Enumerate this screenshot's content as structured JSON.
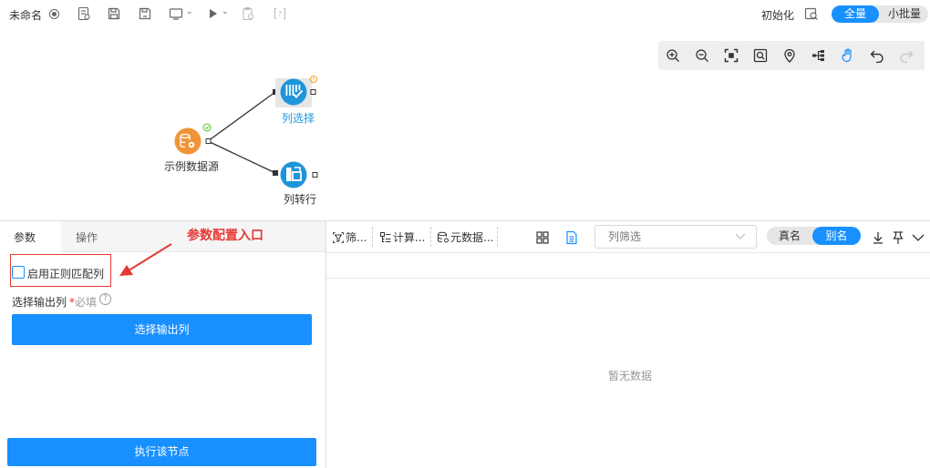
{
  "topbar": {
    "title": "未命名",
    "init_label": "初始化",
    "mode_toggle": {
      "active": "全量",
      "inactive": "小批量"
    }
  },
  "colors": {
    "accent": "#1890ff",
    "annotation": "#e53935",
    "source_node": "#f09438",
    "target_node": "#1f95d9"
  },
  "canvas_tools": [
    "zoom-in-icon",
    "zoom-out-icon",
    "fit-screen-icon",
    "zoom-search-icon",
    "locate-icon",
    "tree-layout-icon",
    "hand-icon",
    "undo-icon",
    "redo-icon"
  ],
  "flow": {
    "nodes": [
      {
        "id": "source",
        "label": "示例数据源",
        "icon": "database-gear-icon"
      },
      {
        "id": "col_select",
        "label": "列选择",
        "icon": "column-select-icon"
      },
      {
        "id": "col_to_row",
        "label": "列转行",
        "icon": "column-to-row-icon"
      }
    ]
  },
  "left_panel": {
    "tabs": [
      "参数",
      "操作"
    ],
    "annotation": "参数配置入口",
    "regex_checkbox": {
      "label": "启用正则匹配列",
      "checked": false
    },
    "output_field": {
      "label": "选择输出列",
      "required_star": "*",
      "required_text": "必填"
    },
    "select_button": "选择输出列",
    "exec_button": "执行该节点"
  },
  "right_panel": {
    "toolbar": {
      "filter_btn": "筛...",
      "compute_btn": "计算...",
      "meta_btn": "元数据..."
    },
    "column_filter": {
      "placeholder": "列筛选"
    },
    "name_toggle": {
      "real": "真名",
      "alias": "别名",
      "active": "别名"
    },
    "empty_text": "暂无数据"
  }
}
